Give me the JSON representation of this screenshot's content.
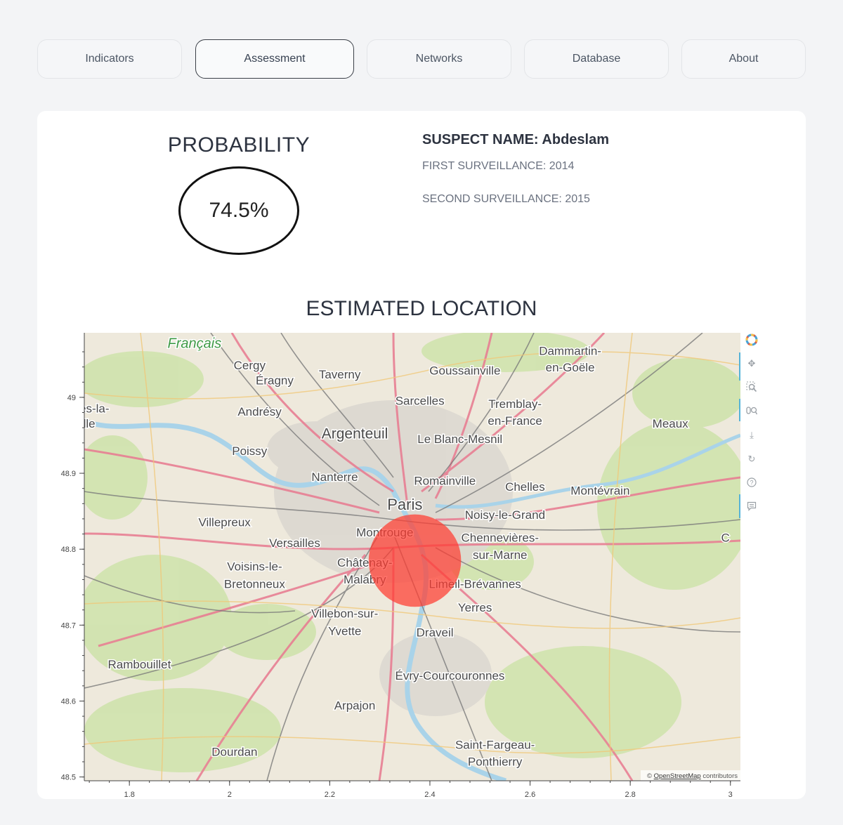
{
  "tabs": [
    {
      "label": "Indicators",
      "active": false
    },
    {
      "label": "Assessment",
      "active": true
    },
    {
      "label": "Networks",
      "active": false
    },
    {
      "label": "Database",
      "active": false
    },
    {
      "label": "About",
      "active": false
    }
  ],
  "probability": {
    "title": "PROBABILITY",
    "value": "74.5%"
  },
  "suspect": {
    "name_label": "SUSPECT NAME:",
    "name": "Abdeslam",
    "first_surveillance": "FIRST SURVEILLANCE: 2014",
    "second_surveillance": "SECOND SURVEILLANCE: 2015"
  },
  "map": {
    "title": "ESTIMATED LOCATION",
    "attribution_prefix": "©",
    "attribution_link": "OpenStreetMap",
    "attribution_suffix": "contributors",
    "marker_color": "#ff3b30",
    "places": [
      {
        "name": "Français",
        "lon": 1.93,
        "lat": 49.065,
        "size": 20,
        "italic": true,
        "color": "#3f9a46"
      },
      {
        "name": "Cergy",
        "lon": 2.04,
        "lat": 49.037,
        "size": 17
      },
      {
        "name": "Éragny",
        "lon": 2.09,
        "lat": 49.017,
        "size": 17
      },
      {
        "name": "Taverny",
        "lon": 2.22,
        "lat": 49.025,
        "size": 17
      },
      {
        "name": "Goussainville",
        "lon": 2.47,
        "lat": 49.03,
        "size": 17
      },
      {
        "name": "Dammartin-",
        "lon": 2.68,
        "lat": 49.056,
        "size": 17
      },
      {
        "name": "en-Goële",
        "lon": 2.68,
        "lat": 49.034,
        "size": 17
      },
      {
        "name": "Sarcelles",
        "lon": 2.38,
        "lat": 48.99,
        "size": 17
      },
      {
        "name": "Tremblay-",
        "lon": 2.57,
        "lat": 48.986,
        "size": 17
      },
      {
        "name": "en-France",
        "lon": 2.57,
        "lat": 48.964,
        "size": 17
      },
      {
        "name": "es-la-",
        "lon": 1.73,
        "lat": 48.98,
        "size": 17
      },
      {
        "name": "lle",
        "lon": 1.72,
        "lat": 48.96,
        "size": 17
      },
      {
        "name": "Andrésy",
        "lon": 2.06,
        "lat": 48.976,
        "size": 17
      },
      {
        "name": "Meaux",
        "lon": 2.88,
        "lat": 48.96,
        "size": 17
      },
      {
        "name": "Argenteuil",
        "lon": 2.25,
        "lat": 48.946,
        "size": 21
      },
      {
        "name": "Le Blanc-Mesnil",
        "lon": 2.46,
        "lat": 48.94,
        "size": 17
      },
      {
        "name": "Poissy",
        "lon": 2.04,
        "lat": 48.924,
        "size": 17
      },
      {
        "name": "Nanterre",
        "lon": 2.21,
        "lat": 48.89,
        "size": 17
      },
      {
        "name": "Romainville",
        "lon": 2.43,
        "lat": 48.885,
        "size": 17
      },
      {
        "name": "Chelles",
        "lon": 2.59,
        "lat": 48.877,
        "size": 17
      },
      {
        "name": "Montévrain",
        "lon": 2.74,
        "lat": 48.872,
        "size": 17
      },
      {
        "name": "Paris",
        "lon": 2.35,
        "lat": 48.852,
        "size": 22
      },
      {
        "name": "Noisy-le-Grand",
        "lon": 2.55,
        "lat": 48.84,
        "size": 17
      },
      {
        "name": "Villepreux",
        "lon": 1.99,
        "lat": 48.83,
        "size": 17
      },
      {
        "name": "Montrouge",
        "lon": 2.31,
        "lat": 48.817,
        "size": 17
      },
      {
        "name": "Chennevières-",
        "lon": 2.54,
        "lat": 48.81,
        "size": 17
      },
      {
        "name": "sur-Marne",
        "lon": 2.54,
        "lat": 48.787,
        "size": 17
      },
      {
        "name": "Versailles",
        "lon": 2.13,
        "lat": 48.803,
        "size": 17
      },
      {
        "name": "Châtenay-",
        "lon": 2.27,
        "lat": 48.777,
        "size": 17
      },
      {
        "name": "Voisins-le-",
        "lon": 2.05,
        "lat": 48.772,
        "size": 17
      },
      {
        "name": "Malabry",
        "lon": 2.27,
        "lat": 48.755,
        "size": 17
      },
      {
        "name": "Limeil-Brévannes",
        "lon": 2.49,
        "lat": 48.749,
        "size": 17
      },
      {
        "name": "Bretonneux",
        "lon": 2.05,
        "lat": 48.749,
        "size": 17
      },
      {
        "name": "C",
        "lon": 2.99,
        "lat": 48.81,
        "size": 17
      },
      {
        "name": "Yerres",
        "lon": 2.49,
        "lat": 48.718,
        "size": 17
      },
      {
        "name": "Villebon-sur-",
        "lon": 2.23,
        "lat": 48.71,
        "size": 17
      },
      {
        "name": "Yvette",
        "lon": 2.23,
        "lat": 48.687,
        "size": 17
      },
      {
        "name": "Draveil",
        "lon": 2.41,
        "lat": 48.685,
        "size": 17
      },
      {
        "name": "Rambouillet",
        "lon": 1.82,
        "lat": 48.643,
        "size": 17
      },
      {
        "name": "Évry-Courcouronnes",
        "lon": 2.44,
        "lat": 48.628,
        "size": 17
      },
      {
        "name": "Arpajon",
        "lon": 2.25,
        "lat": 48.589,
        "size": 17
      },
      {
        "name": "Saint-Fargeau-",
        "lon": 2.53,
        "lat": 48.537,
        "size": 17
      },
      {
        "name": "Ponthierry",
        "lon": 2.53,
        "lat": 48.515,
        "size": 17
      },
      {
        "name": "Dourdan",
        "lon": 2.01,
        "lat": 48.528,
        "size": 17
      }
    ],
    "toolbar_icons": [
      "bokeh-logo-icon",
      "pan-icon",
      "box-zoom-icon",
      "wheel-zoom-icon",
      "save-icon",
      "reset-icon",
      "help-icon",
      "hover-icon"
    ]
  },
  "chart_data": {
    "type": "scatter",
    "title": "ESTIMATED LOCATION",
    "xlabel": "",
    "ylabel": "",
    "xlim": [
      1.71,
      3.02
    ],
    "ylim": [
      48.495,
      49.085
    ],
    "x_ticks": [
      "1.8",
      "2",
      "2.2",
      "2.4",
      "2.6",
      "2.8",
      "3"
    ],
    "y_ticks": [
      "48.5",
      "48.6",
      "48.7",
      "48.8",
      "48.9",
      "49"
    ],
    "x": [
      2.37
    ],
    "y": [
      48.785
    ],
    "radius": [
      0.13
    ],
    "color": "#ff3b30",
    "grid": false
  }
}
